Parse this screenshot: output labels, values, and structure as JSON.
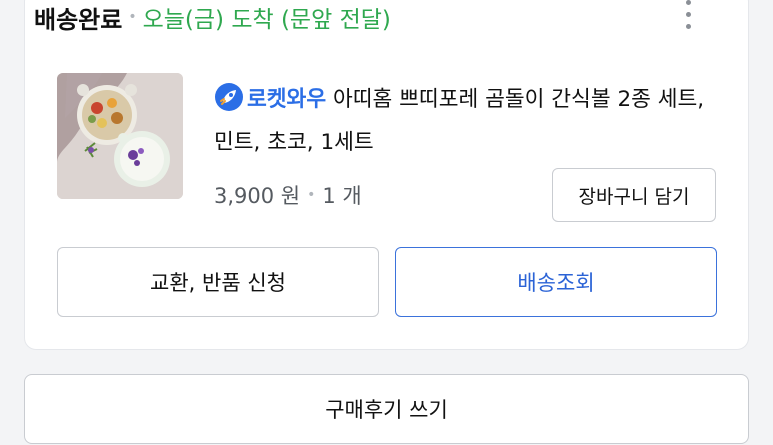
{
  "order": {
    "status": "배송완료",
    "delivery_note": "오늘(금) 도착 (문앞 전달)"
  },
  "product": {
    "badge_label": "로켓와우",
    "badge_icon": "rocket-icon",
    "name": "아띠홈 쁘띠포레 곰돌이 간식볼 2종 세트, 민트, 초코, 1세트",
    "price": "3,900 원",
    "quantity": "1 개",
    "add_to_cart_label": "장바구니 담기"
  },
  "actions": {
    "exchange_return_label": "교환, 반품 신청",
    "track_delivery_label": "배송조회",
    "write_review_label": "구매후기 쓰기"
  },
  "colors": {
    "status_green": "#2fa84f",
    "rocket_blue": "#2b6ee6",
    "primary_button_blue": "#3b72db"
  }
}
